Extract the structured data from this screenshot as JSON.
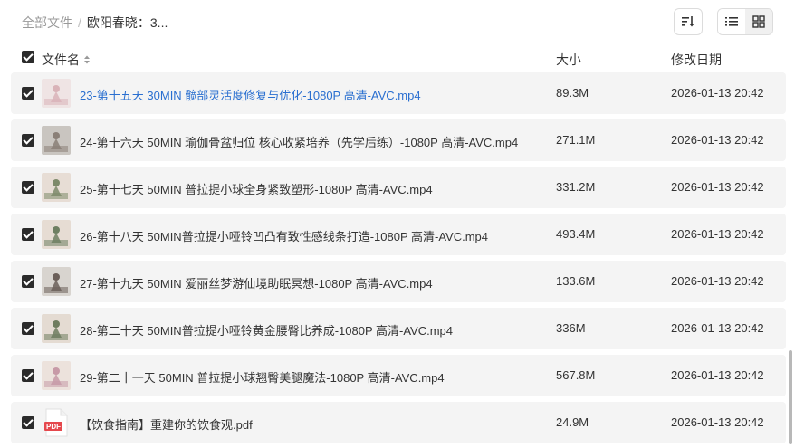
{
  "breadcrumb": {
    "root": "全部文件",
    "separator": "/",
    "current": "欧阳春晓：3..."
  },
  "header": {
    "name": "文件名",
    "size": "大小",
    "modified": "修改日期"
  },
  "files": [
    {
      "name": "23-第十五天 30MIN 髋部灵活度修复与优化-1080P 高清-AVC.mp4",
      "size": "89.3M",
      "date": "2026-01-13 20:42",
      "icon": "video-thumbnail-icon",
      "thumb_bg": "#efe4e4",
      "thumb_fg": "#d9b3b8"
    },
    {
      "name": "24-第十六天 50MIN 瑜伽骨盆归位 核心收紧培养（先学后练）-1080P 高清-AVC.mp4",
      "size": "271.1M",
      "date": "2026-01-13 20:42",
      "icon": "video-thumbnail-icon",
      "thumb_bg": "#c9c5c0",
      "thumb_fg": "#8a7f77"
    },
    {
      "name": "25-第十七天 50MIN 普拉提小球全身紧致塑形-1080P 高清-AVC.mp4",
      "size": "331.2M",
      "date": "2026-01-13 20:42",
      "icon": "video-thumbnail-icon",
      "thumb_bg": "#e7ddd5",
      "thumb_fg": "#7d8a6a"
    },
    {
      "name": "26-第十八天 50MIN普拉提小哑铃凹凸有致性感线条打造-1080P 高清-AVC.mp4",
      "size": "493.4M",
      "date": "2026-01-13 20:42",
      "icon": "video-thumbnail-icon",
      "thumb_bg": "#e6dcd3",
      "thumb_fg": "#6e7f62"
    },
    {
      "name": "27-第十九天 50MIN 爱丽丝梦游仙境助眠冥想-1080P 高清-AVC.mp4",
      "size": "133.6M",
      "date": "2026-01-13 20:42",
      "icon": "video-thumbnail-icon",
      "thumb_bg": "#d8d4cf",
      "thumb_fg": "#6b5f59"
    },
    {
      "name": "28-第二十天 50MIN普拉提小哑铃黄金腰臀比养成-1080P 高清-AVC.mp4",
      "size": "336M",
      "date": "2026-01-13 20:42",
      "icon": "video-thumbnail-icon",
      "thumb_bg": "#e4dbd2",
      "thumb_fg": "#6f7d5f"
    },
    {
      "name": "29-第二十一天 50MIN 普拉提小球翘臀美腿魔法-1080P 高清-AVC.mp4",
      "size": "567.8M",
      "date": "2026-01-13 20:42",
      "icon": "video-thumbnail-icon",
      "thumb_bg": "#ece2dc",
      "thumb_fg": "#c79aa7"
    },
    {
      "name": "【饮食指南】重建你的饮食观.pdf",
      "size": "24.9M",
      "date": "2026-01-13 20:42",
      "icon": "pdf-icon",
      "badge": "PDF"
    }
  ],
  "colors": {
    "link": "#2a6fd0",
    "row_bg": "#f4f4f4",
    "checkbox": "#2b2b2b",
    "pdf_red": "#e5484d"
  }
}
